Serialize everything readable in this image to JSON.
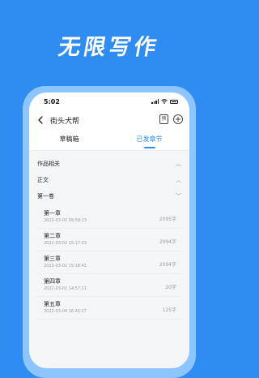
{
  "promo": {
    "title": "无限写作"
  },
  "status": {
    "time": "5:02"
  },
  "nav": {
    "title": "街头犬帮",
    "preview_label": "预"
  },
  "tabs": [
    {
      "label": "草稿箱",
      "active": false
    },
    {
      "label": "已发章节",
      "active": true
    }
  ],
  "sections": [
    {
      "label": "作品相关",
      "chevron": "chevron-up"
    },
    {
      "label": "正文",
      "chevron": "chevron-up"
    },
    {
      "label": "第一卷",
      "chevron": "chevron-down"
    }
  ],
  "chapters": [
    {
      "title": "第一章",
      "date": "2022-03-02 09:59:23",
      "count": "2095字"
    },
    {
      "title": "第二章",
      "date": "2022-03-02 15:17:03",
      "count": "2094字"
    },
    {
      "title": "第三章",
      "date": "2022-03-02 15:18:41",
      "count": "2094字"
    },
    {
      "title": "第四章",
      "date": "2022-03-02 14:57:11",
      "count": "20字"
    },
    {
      "title": "第五章",
      "date": "2022-03-04 16:42:27",
      "count": "125字"
    }
  ],
  "colors": {
    "background": "#2f8cf0",
    "accent": "#2f8cf0",
    "phone_frame": "#8cc5ff"
  }
}
